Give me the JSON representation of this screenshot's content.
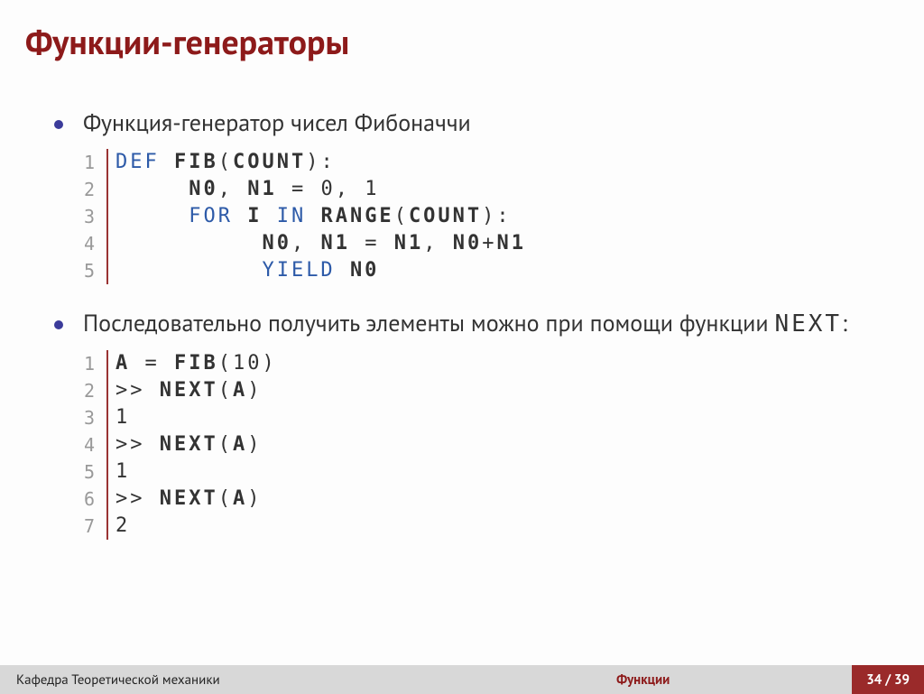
{
  "title": "Функции-генераторы",
  "bullets": {
    "b1": "Функция-генератор чисел Фибоначчи",
    "b2_prefix": "Последовательно получить элементы можно при помощи функции ",
    "b2_code": "NEXT",
    "b2_suffix": ":"
  },
  "code1": {
    "lines": [
      {
        "n": "1",
        "seg": [
          {
            "c": "kw",
            "t": "DEF "
          },
          {
            "c": "fn",
            "t": "FIB"
          },
          {
            "c": "",
            "t": "("
          },
          {
            "c": "id",
            "t": "COUNT"
          },
          {
            "c": "",
            "t": "):"
          }
        ],
        "indent": 0
      },
      {
        "n": "2",
        "seg": [
          {
            "c": "id",
            "t": "N0"
          },
          {
            "c": "",
            "t": ", "
          },
          {
            "c": "id",
            "t": "N1"
          },
          {
            "c": "",
            "t": " = 0, 1"
          }
        ],
        "indent": 1
      },
      {
        "n": "3",
        "seg": [
          {
            "c": "kw",
            "t": "FOR "
          },
          {
            "c": "id",
            "t": "I"
          },
          {
            "c": "kw",
            "t": " IN "
          },
          {
            "c": "fn",
            "t": "RANGE"
          },
          {
            "c": "",
            "t": "("
          },
          {
            "c": "id",
            "t": "COUNT"
          },
          {
            "c": "",
            "t": "):"
          }
        ],
        "indent": 1
      },
      {
        "n": "4",
        "seg": [
          {
            "c": "id",
            "t": "N0"
          },
          {
            "c": "",
            "t": ", "
          },
          {
            "c": "id",
            "t": "N1"
          },
          {
            "c": "",
            "t": " = "
          },
          {
            "c": "id",
            "t": "N1"
          },
          {
            "c": "",
            "t": ", "
          },
          {
            "c": "id",
            "t": "N0"
          },
          {
            "c": "",
            "t": "+"
          },
          {
            "c": "id",
            "t": "N1"
          }
        ],
        "indent": 2
      },
      {
        "n": "5",
        "seg": [
          {
            "c": "kw",
            "t": "YIELD "
          },
          {
            "c": "id",
            "t": "N0"
          }
        ],
        "indent": 2
      }
    ]
  },
  "code2": {
    "lines": [
      {
        "n": "1",
        "seg": [
          {
            "c": "id",
            "t": "A"
          },
          {
            "c": "",
            "t": " = "
          },
          {
            "c": "fn",
            "t": "FIB"
          },
          {
            "c": "",
            "t": "(10)"
          }
        ],
        "indent": 0
      },
      {
        "n": "2",
        "seg": [
          {
            "c": "",
            "t": ">> "
          },
          {
            "c": "fn",
            "t": "NEXT"
          },
          {
            "c": "",
            "t": "("
          },
          {
            "c": "id",
            "t": "A"
          },
          {
            "c": "",
            "t": ")"
          }
        ],
        "indent": 0
      },
      {
        "n": "3",
        "seg": [
          {
            "c": "",
            "t": "1"
          }
        ],
        "indent": 0
      },
      {
        "n": "4",
        "seg": [
          {
            "c": "",
            "t": ">> "
          },
          {
            "c": "fn",
            "t": "NEXT"
          },
          {
            "c": "",
            "t": "("
          },
          {
            "c": "id",
            "t": "A"
          },
          {
            "c": "",
            "t": ")"
          }
        ],
        "indent": 0
      },
      {
        "n": "5",
        "seg": [
          {
            "c": "",
            "t": "1"
          }
        ],
        "indent": 0
      },
      {
        "n": "6",
        "seg": [
          {
            "c": "",
            "t": ">> "
          },
          {
            "c": "fn",
            "t": "NEXT"
          },
          {
            "c": "",
            "t": "("
          },
          {
            "c": "id",
            "t": "A"
          },
          {
            "c": "",
            "t": ")"
          }
        ],
        "indent": 0
      },
      {
        "n": "7",
        "seg": [
          {
            "c": "",
            "t": "2"
          }
        ],
        "indent": 0
      }
    ]
  },
  "footer": {
    "left": "Кафедра Теоретической механики",
    "center": "Функции",
    "right": "34 / 39"
  }
}
